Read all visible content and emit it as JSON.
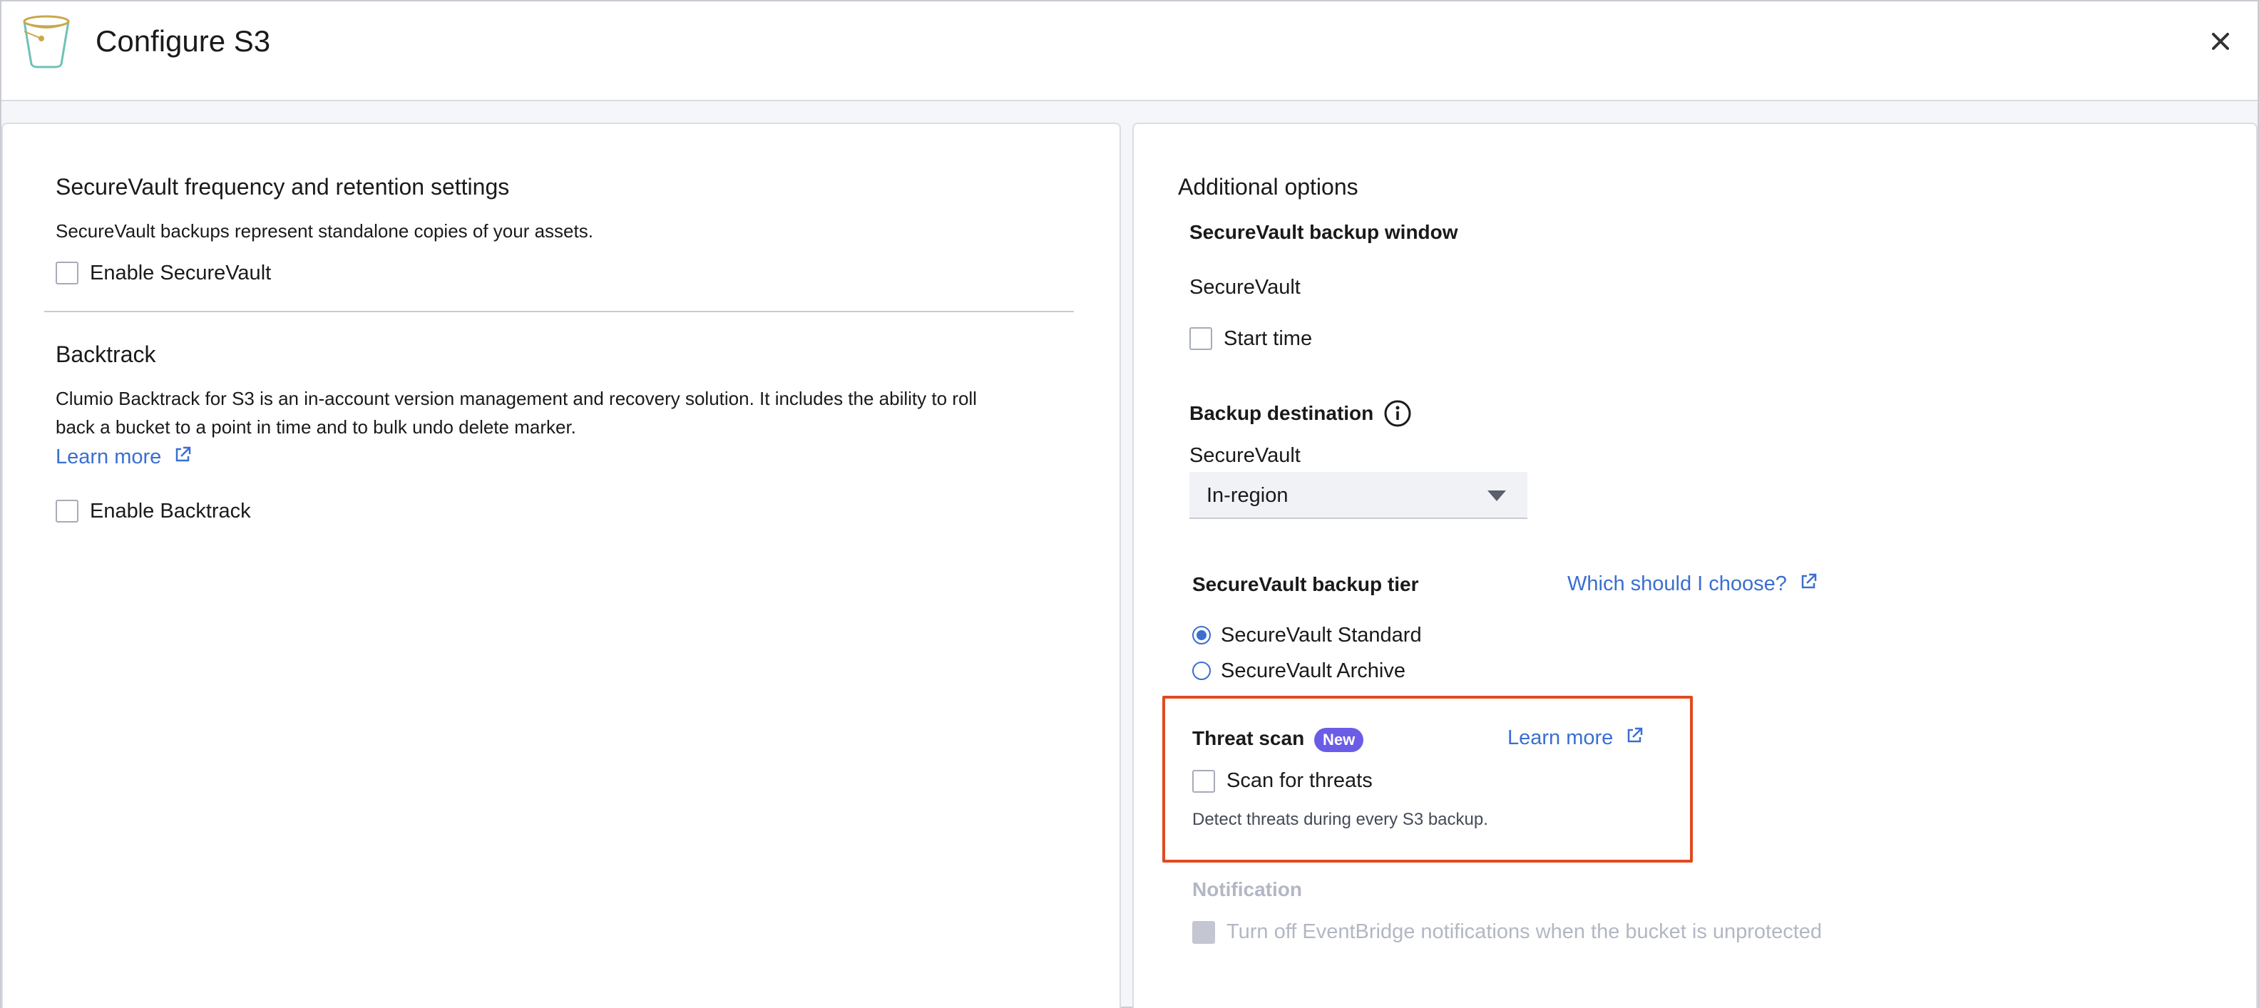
{
  "header": {
    "title": "Configure S3",
    "icon": "bucket-icon",
    "close_icon": "close-icon"
  },
  "left": {
    "securevault": {
      "heading": "SecureVault  frequency and retention settings",
      "description": "SecureVault backups represent standalone copies of your assets.",
      "checkbox_label": "Enable SecureVault"
    },
    "backtrack": {
      "heading": "Backtrack",
      "description_line1": "Clumio Backtrack for S3 is an in-account version management and recovery solution. It includes the ability to roll",
      "description_line2": "back a bucket to a point in time and to bulk undo delete marker.",
      "learn_more": "Learn more",
      "checkbox_label": "Enable Backtrack"
    }
  },
  "right": {
    "heading": "Additional options",
    "backup_window": {
      "heading": "SecureVault backup window",
      "sublabel": "SecureVault",
      "checkbox_label": "Start time"
    },
    "destination": {
      "heading": "Backup destination",
      "sublabel": "SecureVault",
      "selected": "In-region"
    },
    "tier": {
      "heading": "SecureVault backup tier",
      "help_link": "Which should I choose?",
      "options": [
        "SecureVault Standard",
        "SecureVault Archive"
      ],
      "selected": "SecureVault Standard"
    },
    "threat_scan": {
      "heading": "Threat scan",
      "badge": "New",
      "learn_more": "Learn more",
      "checkbox_label": "Scan for threats",
      "hint": "Detect threats during every S3 backup."
    },
    "notification": {
      "heading": "Notification",
      "checkbox_label": "Turn off EventBridge notifications when the bucket is unprotected"
    }
  },
  "colors": {
    "accent": "#3a6fd0",
    "badge": "#6b5ce7",
    "highlight": "#e04a1f",
    "muted": "#b3b7c4"
  }
}
